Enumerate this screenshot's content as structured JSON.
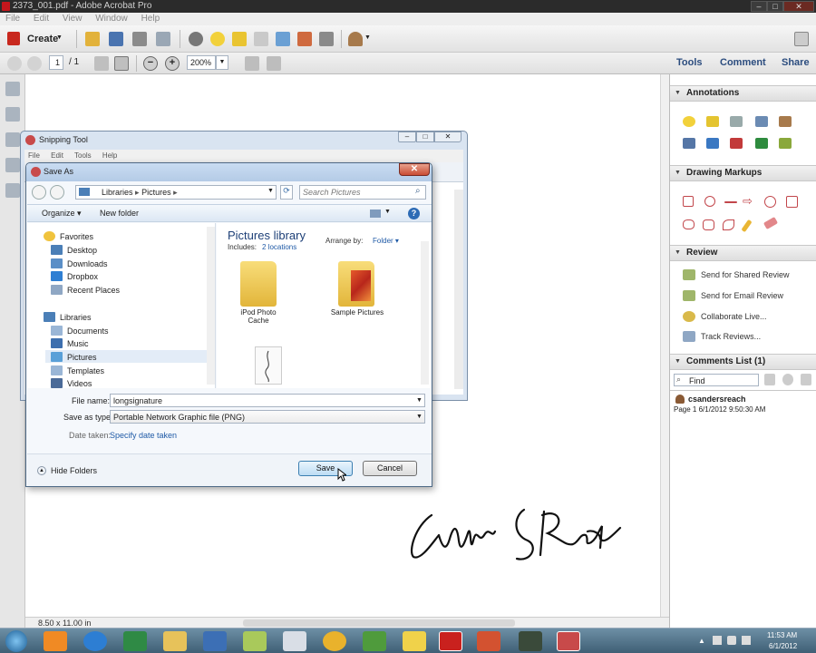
{
  "window": {
    "title": "2373_001.pdf - Adobe Acrobat Pro"
  },
  "menu": [
    "File",
    "Edit",
    "View",
    "Window",
    "Help"
  ],
  "toolbar": {
    "create_label": "Create",
    "page_current": "1",
    "page_total": "/ 1",
    "zoom": "200%"
  },
  "right_tabs": {
    "tools": "Tools",
    "comment": "Comment",
    "share": "Share"
  },
  "panels": {
    "annotations": "Annotations",
    "drawing": "Drawing Markups",
    "review": "Review",
    "review_items": [
      "Send for Shared Review",
      "Send for Email Review",
      "Collaborate Live...",
      "Track Reviews..."
    ],
    "comments": "Comments List (1)",
    "find_placeholder": "Find",
    "comment_author": "csandersreach",
    "comment_meta": "Page 1  6/1/2012 9:50:30 AM"
  },
  "status": {
    "page_size": "8.50 x 11.00 in"
  },
  "snipping": {
    "title": "Snipping Tool",
    "menu": [
      "File",
      "Edit",
      "Tools",
      "Help"
    ]
  },
  "saveas": {
    "title": "Save As",
    "breadcrumb": [
      "Libraries",
      "Pictures"
    ],
    "search_placeholder": "Search Pictures",
    "organize": "Organize",
    "new_folder": "New folder",
    "nav": {
      "favorites": "Favorites",
      "favorites_items": [
        "Desktop",
        "Downloads",
        "Dropbox",
        "Recent Places"
      ],
      "libraries": "Libraries",
      "libraries_items": [
        "Documents",
        "Music",
        "Pictures",
        "Templates",
        "Videos"
      ]
    },
    "library_title": "Pictures library",
    "includes_label": "Includes:",
    "includes_link": "2 locations",
    "arrange_label": "Arrange by:",
    "arrange_value": "Folder",
    "items": [
      "iPod Photo Cache",
      "Sample Pictures"
    ],
    "filename_label": "File name:",
    "filename_value": "longsignature",
    "type_label": "Save as type:",
    "type_value": "Portable Network Graphic file (PNG)",
    "date_label": "Date taken:",
    "date_value": "Specify date taken",
    "hide_folders": "Hide Folders",
    "save": "Save",
    "cancel": "Cancel"
  },
  "clock": {
    "time": "11:53 AM",
    "date": "6/1/2012"
  }
}
